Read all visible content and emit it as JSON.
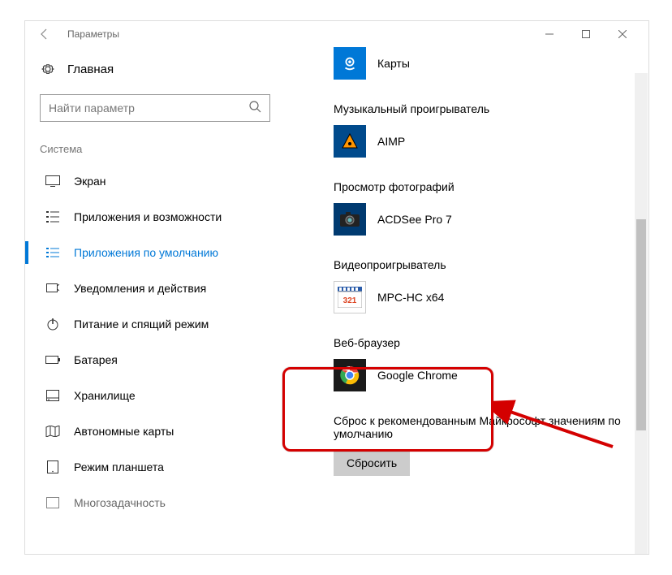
{
  "window": {
    "title": "Параметры"
  },
  "sidebar": {
    "home": "Главная",
    "search_placeholder": "Найти параметр",
    "section": "Система",
    "items": [
      {
        "label": "Экран"
      },
      {
        "label": "Приложения и возможности"
      },
      {
        "label": "Приложения по умолчанию"
      },
      {
        "label": "Уведомления и действия"
      },
      {
        "label": "Питание и спящий режим"
      },
      {
        "label": "Батарея"
      },
      {
        "label": "Хранилище"
      },
      {
        "label": "Автономные карты"
      },
      {
        "label": "Режим планшета"
      },
      {
        "label": "Многозадачность"
      }
    ]
  },
  "defaults": {
    "maps": {
      "title": "",
      "app": "Карты"
    },
    "music": {
      "title": "Музыкальный проигрыватель",
      "app": "AIMP"
    },
    "photos": {
      "title": "Просмотр фотографий",
      "app": "ACDSee Pro 7"
    },
    "video": {
      "title": "Видеопроигрыватель",
      "app": "MPC-HC x64"
    },
    "browser": {
      "title": "Веб-браузер",
      "app": "Google Chrome"
    }
  },
  "reset": {
    "description": "Сброс к рекомендованным Майкрософт значениям по умолчанию",
    "button": "Сбросить"
  },
  "colors": {
    "accent": "#0078D7",
    "highlight": "#d40000"
  }
}
